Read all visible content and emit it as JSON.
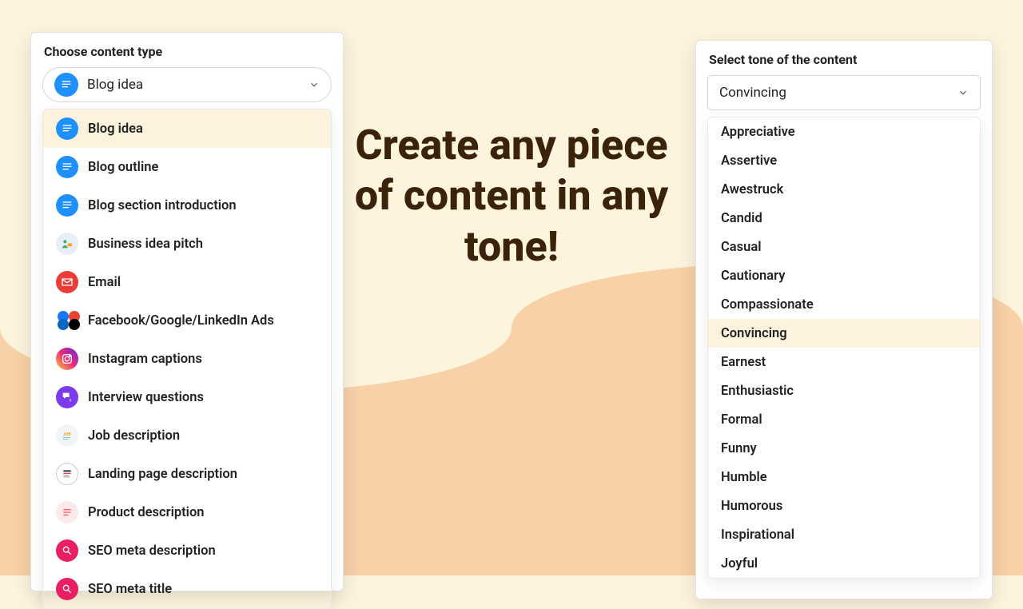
{
  "hero": "Create any piece of content in any tone!",
  "panels": {
    "left": {
      "label": "Choose content type",
      "selected": "Blog idea"
    },
    "right": {
      "label": "Select tone of the content",
      "selected": "Convincing"
    }
  },
  "content_types": [
    {
      "label": "Blog idea",
      "icon": "blog"
    },
    {
      "label": "Blog outline",
      "icon": "blog"
    },
    {
      "label": "Blog section introduction",
      "icon": "blog"
    },
    {
      "label": "Business idea pitch",
      "icon": "biz"
    },
    {
      "label": "Email",
      "icon": "email"
    },
    {
      "label": "Facebook/Google/LinkedIn Ads",
      "icon": "ads"
    },
    {
      "label": "Instagram captions",
      "icon": "ig"
    },
    {
      "label": "Interview questions",
      "icon": "interview"
    },
    {
      "label": "Job description",
      "icon": "job"
    },
    {
      "label": "Landing page description",
      "icon": "land"
    },
    {
      "label": "Product description",
      "icon": "prod"
    },
    {
      "label": "SEO meta description",
      "icon": "seo"
    },
    {
      "label": "SEO meta title",
      "icon": "seo"
    }
  ],
  "tones": [
    "Appreciative",
    "Assertive",
    "Awestruck",
    "Candid",
    "Casual",
    "Cautionary",
    "Compassionate",
    "Convincing",
    "Earnest",
    "Enthusiastic",
    "Formal",
    "Funny",
    "Humble",
    "Humorous",
    "Inspirational",
    "Joyful"
  ]
}
